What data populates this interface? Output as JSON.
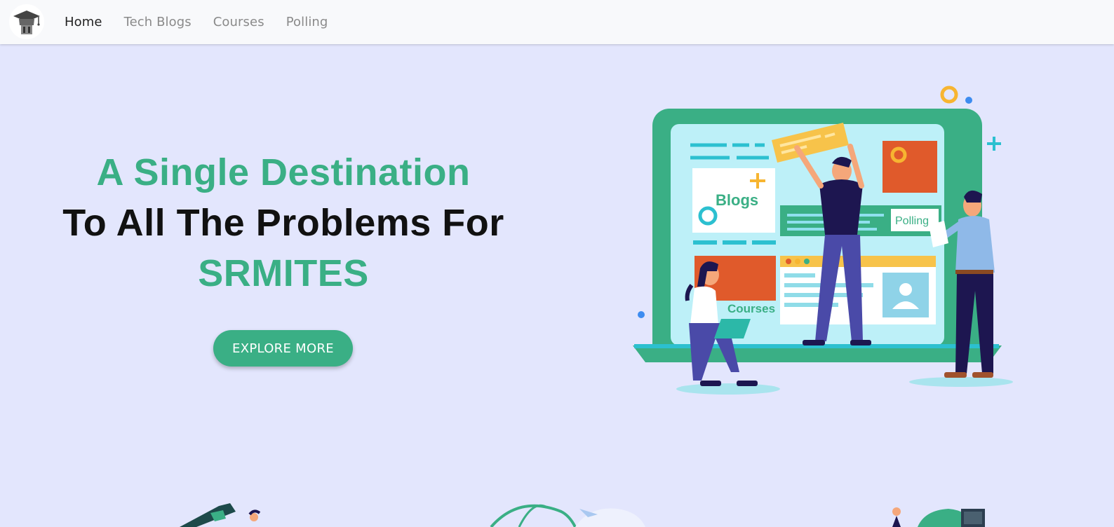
{
  "navbar": {
    "logo_icon": "graduation-cap-icon",
    "links": [
      {
        "label": "Home",
        "active": true
      },
      {
        "label": "Tech Blogs",
        "active": false
      },
      {
        "label": "Courses",
        "active": false
      },
      {
        "label": "Polling",
        "active": false
      }
    ]
  },
  "hero": {
    "line1": "A Single Destination",
    "line2": "To All The Problems For",
    "line3": "SRMITES",
    "button_label": "EXPLORE MORE",
    "illustration": {
      "blogs_label": "Blogs",
      "polling_label": "Polling",
      "courses_label": "Courses"
    }
  },
  "colors": {
    "background": "#e3e6fd",
    "accent": "#3aaf85",
    "navbar": "#f8f9fb",
    "heading_dark": "#111111"
  }
}
